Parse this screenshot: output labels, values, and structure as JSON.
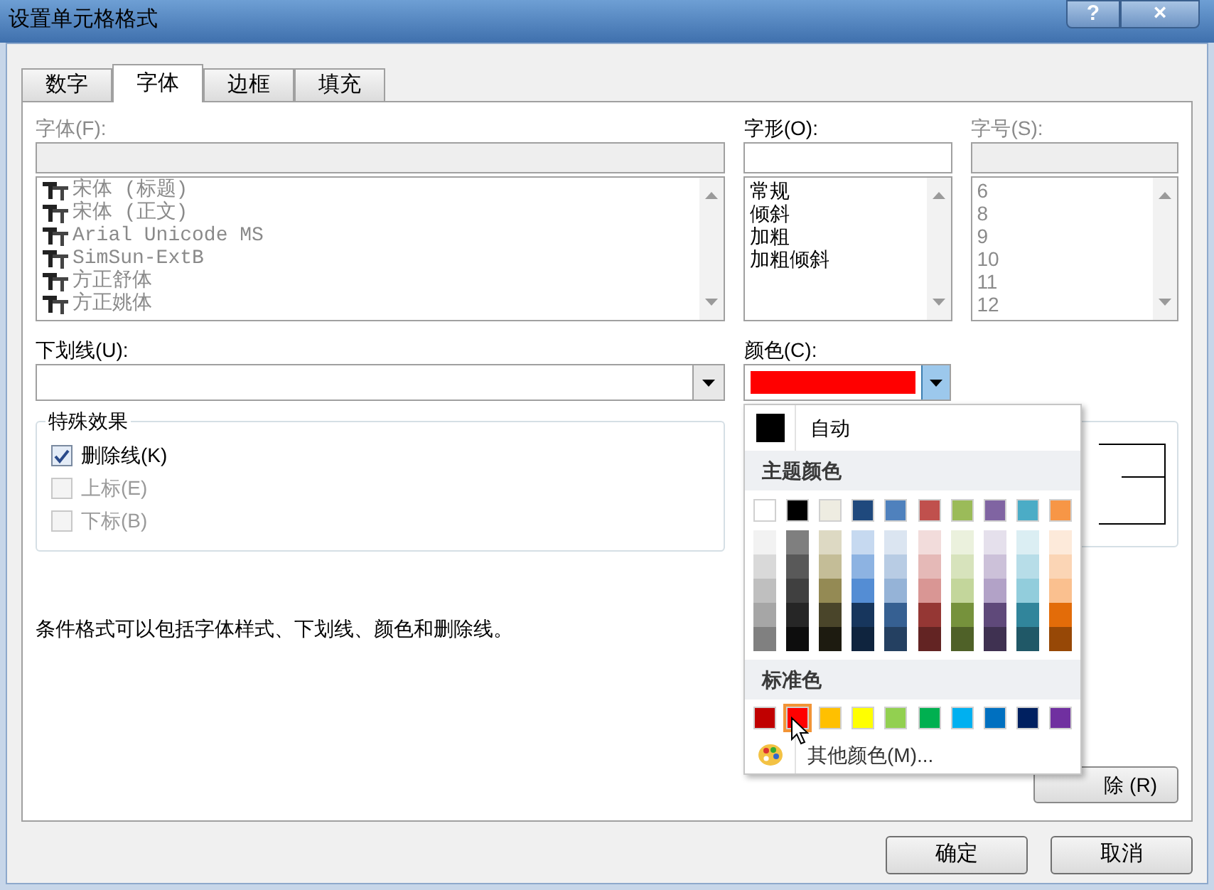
{
  "window": {
    "title": "设置单元格格式",
    "help_button": "?",
    "close_button": "×"
  },
  "tabs": [
    {
      "label": "数字",
      "selected": false
    },
    {
      "label": "字体",
      "selected": true
    },
    {
      "label": "边框",
      "selected": false
    },
    {
      "label": "填充",
      "selected": false
    }
  ],
  "font": {
    "label": "字体(F):",
    "disabled": true,
    "items": [
      {
        "label": "宋体 (标题)",
        "selected": false
      },
      {
        "label": "宋体 (正文)",
        "selected": false
      },
      {
        "label": "Arial Unicode MS",
        "selected": false
      },
      {
        "label": "SimSun-ExtB",
        "selected": false
      },
      {
        "label": "方正舒体",
        "selected": false
      },
      {
        "label": "方正姚体",
        "selected": false
      }
    ]
  },
  "style": {
    "label": "字形(O):",
    "disabled": false,
    "items": [
      {
        "label": "常规",
        "selected": false
      },
      {
        "label": "倾斜",
        "selected": false
      },
      {
        "label": "加粗",
        "selected": false
      },
      {
        "label": "加粗倾斜",
        "selected": false
      }
    ]
  },
  "size": {
    "label": "字号(S):",
    "disabled": true,
    "items": [
      {
        "label": "6",
        "selected": false
      },
      {
        "label": "8",
        "selected": false
      },
      {
        "label": "9",
        "selected": false
      },
      {
        "label": "10",
        "selected": false
      },
      {
        "label": "11",
        "selected": false
      },
      {
        "label": "12",
        "selected": false
      }
    ]
  },
  "underline": {
    "label": "下划线(U):"
  },
  "color": {
    "label": "颜色(C):",
    "color": "#ff0000",
    "expanded": true
  },
  "effects": {
    "title": "特殊效果",
    "items": [
      {
        "label": "删除线(K)",
        "checked": true,
        "disabled": false
      },
      {
        "label": "上标(E)",
        "checked": false,
        "disabled": true
      },
      {
        "label": "下标(B)",
        "checked": false,
        "disabled": true
      }
    ]
  },
  "note": "条件格式可以包括字体样式、下划线、颜色和删除线。",
  "clear_button": "除 (R)",
  "color_popup": {
    "auto": {
      "label": "自动",
      "color": "#000000"
    },
    "theme_title": "主题颜色",
    "theme_colors": [
      {
        "color": "#ffffff",
        "selected": false,
        "shades": [
          {
            "color": "#f2f2f2",
            "selected": false
          },
          {
            "color": "#d9d9d9",
            "selected": false
          },
          {
            "color": "#bfbfbf",
            "selected": false
          },
          {
            "color": "#a6a6a6",
            "selected": false
          },
          {
            "color": "#808080",
            "selected": false
          }
        ]
      },
      {
        "color": "#000000",
        "selected": false,
        "shades": [
          {
            "color": "#7f7f7f",
            "selected": false
          },
          {
            "color": "#595959",
            "selected": false
          },
          {
            "color": "#404040",
            "selected": false
          },
          {
            "color": "#262626",
            "selected": false
          },
          {
            "color": "#0d0d0d",
            "selected": false
          }
        ]
      },
      {
        "color": "#eeece1",
        "selected": false,
        "shades": [
          {
            "color": "#ddd9c3",
            "selected": false
          },
          {
            "color": "#c4bd97",
            "selected": false
          },
          {
            "color": "#948a54",
            "selected": false
          },
          {
            "color": "#4a452a",
            "selected": false
          },
          {
            "color": "#1d1b10",
            "selected": false
          }
        ]
      },
      {
        "color": "#1f497d",
        "selected": false,
        "shades": [
          {
            "color": "#c6d9f0",
            "selected": false
          },
          {
            "color": "#8db3e2",
            "selected": false
          },
          {
            "color": "#548dd4",
            "selected": false
          },
          {
            "color": "#17365d",
            "selected": false
          },
          {
            "color": "#0f243e",
            "selected": false
          }
        ]
      },
      {
        "color": "#4f81bd",
        "selected": false,
        "shades": [
          {
            "color": "#dbe5f1",
            "selected": false
          },
          {
            "color": "#b8cce4",
            "selected": false
          },
          {
            "color": "#95b3d7",
            "selected": false
          },
          {
            "color": "#366092",
            "selected": false
          },
          {
            "color": "#244061",
            "selected": false
          }
        ]
      },
      {
        "color": "#c0504d",
        "selected": false,
        "shades": [
          {
            "color": "#f2dcdb",
            "selected": false
          },
          {
            "color": "#e5b9b7",
            "selected": false
          },
          {
            "color": "#d99694",
            "selected": false
          },
          {
            "color": "#953734",
            "selected": false
          },
          {
            "color": "#632423",
            "selected": false
          }
        ]
      },
      {
        "color": "#9bbb59",
        "selected": false,
        "shades": [
          {
            "color": "#ebf1dd",
            "selected": false
          },
          {
            "color": "#d7e3bc",
            "selected": false
          },
          {
            "color": "#c3d69b",
            "selected": false
          },
          {
            "color": "#76923c",
            "selected": false
          },
          {
            "color": "#4f6128",
            "selected": false
          }
        ]
      },
      {
        "color": "#8064a2",
        "selected": false,
        "shades": [
          {
            "color": "#e5e0ec",
            "selected": false
          },
          {
            "color": "#ccc1d9",
            "selected": false
          },
          {
            "color": "#b2a2c7",
            "selected": false
          },
          {
            "color": "#5f497a",
            "selected": false
          },
          {
            "color": "#3f3151",
            "selected": false
          }
        ]
      },
      {
        "color": "#4bacc6",
        "selected": false,
        "shades": [
          {
            "color": "#dbeef3",
            "selected": false
          },
          {
            "color": "#b7dde8",
            "selected": false
          },
          {
            "color": "#92cddc",
            "selected": false
          },
          {
            "color": "#31859b",
            "selected": false
          },
          {
            "color": "#205867",
            "selected": false
          }
        ]
      },
      {
        "color": "#f79646",
        "selected": false,
        "shades": [
          {
            "color": "#fdeada",
            "selected": false
          },
          {
            "color": "#fbd5b5",
            "selected": false
          },
          {
            "color": "#fac08f",
            "selected": false
          },
          {
            "color": "#e36c09",
            "selected": false
          },
          {
            "color": "#974806",
            "selected": false
          }
        ]
      }
    ],
    "standard_title": "标准色",
    "standard_colors": [
      {
        "color": "#c00000",
        "selected": false
      },
      {
        "color": "#ff0000",
        "selected": true
      },
      {
        "color": "#ffc000",
        "selected": false
      },
      {
        "color": "#ffff00",
        "selected": false
      },
      {
        "color": "#92d050",
        "selected": false
      },
      {
        "color": "#00b050",
        "selected": false
      },
      {
        "color": "#00b0f0",
        "selected": false
      },
      {
        "color": "#0070c0",
        "selected": false
      },
      {
        "color": "#002060",
        "selected": false
      },
      {
        "color": "#7030a0",
        "selected": false
      }
    ],
    "more_colors": "其他颜色(M)..."
  },
  "buttons": [
    {
      "label": "确定"
    },
    {
      "label": "取消"
    }
  ]
}
